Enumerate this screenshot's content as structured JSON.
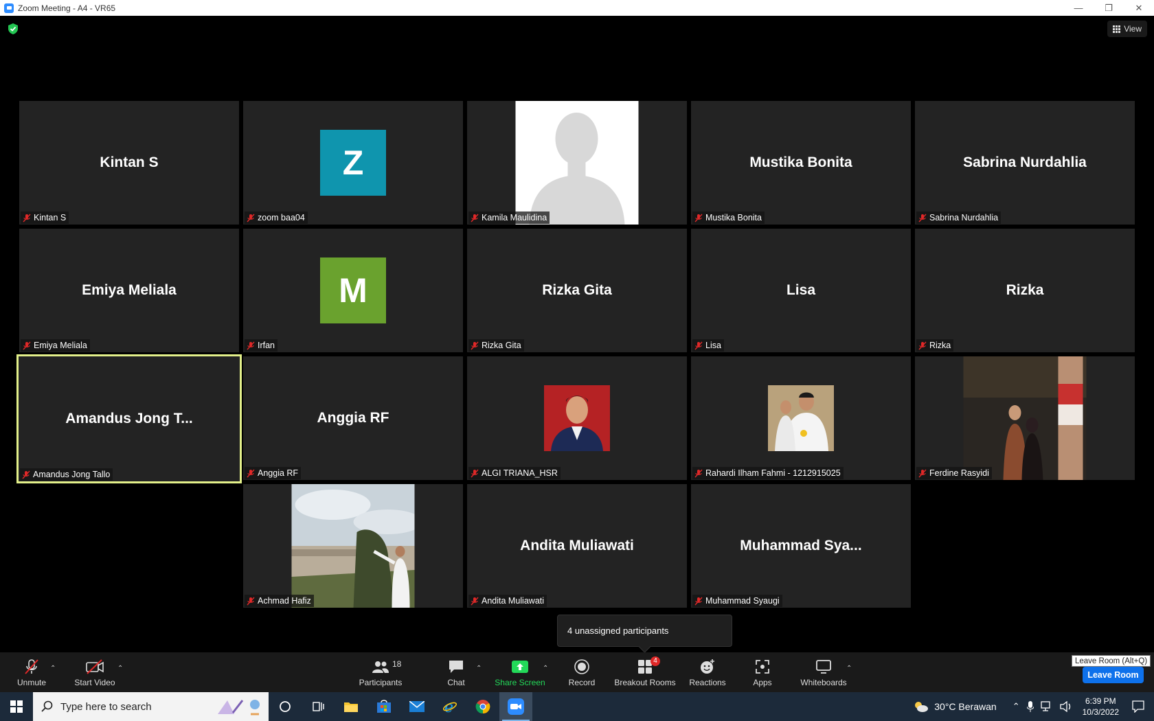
{
  "window": {
    "title": "Zoom Meeting - A4 - VR65",
    "minimize": "—",
    "restore": "❐",
    "close": "✕"
  },
  "view_button": {
    "label": "View"
  },
  "tiles": [
    {
      "id": "kintan",
      "display": "Kintan S",
      "label": "Kintan S",
      "kind": "name"
    },
    {
      "id": "zoom-baa04",
      "display": "Z",
      "label": "zoom baa04",
      "kind": "letter",
      "color": "#0f95ae"
    },
    {
      "id": "kamila",
      "display": "",
      "label": "Kamila Maulidina",
      "kind": "silhouette"
    },
    {
      "id": "mustika",
      "display": "Mustika Bonita",
      "label": "Mustika Bonita",
      "kind": "name"
    },
    {
      "id": "sabrina",
      "display": "Sabrina Nurdahlia",
      "label": "Sabrina Nurdahlia",
      "kind": "name"
    },
    {
      "id": "emiya",
      "display": "Emiya Meliala",
      "label": "Emiya Meliala",
      "kind": "name"
    },
    {
      "id": "irfan",
      "display": "M",
      "label": "Irfan",
      "kind": "letter",
      "color": "#6aa22e"
    },
    {
      "id": "rizka-gita",
      "display": "Rizka Gita",
      "label": "Rizka Gita",
      "kind": "name"
    },
    {
      "id": "lisa",
      "display": "Lisa",
      "label": "Lisa",
      "kind": "name"
    },
    {
      "id": "rizka",
      "display": "Rizka",
      "label": "Rizka",
      "kind": "name"
    },
    {
      "id": "amandus",
      "display": "Amandus Jong T...",
      "label": "Amandus Jong Tallo",
      "kind": "name",
      "active": true
    },
    {
      "id": "anggia",
      "display": "Anggia RF",
      "label": "Anggia RF",
      "kind": "name"
    },
    {
      "id": "algi",
      "display": "",
      "label": "ALGI TRIANA_HSR",
      "kind": "photo-portrait"
    },
    {
      "id": "rahardi",
      "display": "",
      "label": "Rahardi Ilham Fahmi - 1212915025",
      "kind": "photo-portrait"
    },
    {
      "id": "ferdine",
      "display": "",
      "label": "Ferdine Rasyidi",
      "kind": "photo-night"
    },
    {
      "id": "achmad",
      "display": "",
      "label": "Achmad Hafiz",
      "kind": "photo-landscape"
    },
    {
      "id": "andita",
      "display": "Andita Muliawati",
      "label": "Andita Muliawati",
      "kind": "name"
    },
    {
      "id": "muhammad",
      "display": "Muhammad  Sya...",
      "label": "Muhammad Syaugi",
      "kind": "name"
    }
  ],
  "unassigned_tooltip": "4 unassigned participants",
  "toolbar": {
    "unmute": "Unmute",
    "start_video": "Start Video",
    "participants": "Participants",
    "participants_count": "18",
    "chat": "Chat",
    "share_screen": "Share Screen",
    "record": "Record",
    "breakout_rooms": "Breakout Rooms",
    "breakout_badge": "4",
    "reactions": "Reactions",
    "apps": "Apps",
    "whiteboards": "Whiteboards",
    "leave_room": "Leave Room",
    "leave_tooltip": "Leave Room (Alt+Q)",
    "caret": "⌃"
  },
  "taskbar": {
    "search_placeholder": "Type here to search",
    "weather": "30°C  Berawan",
    "time": "6:39 PM",
    "date": "10/3/2022"
  },
  "colors": {
    "active_speaker": "#e3f08a",
    "share_green": "#23d959",
    "leave_blue": "#0e71eb",
    "muted_red": "#e02828"
  }
}
